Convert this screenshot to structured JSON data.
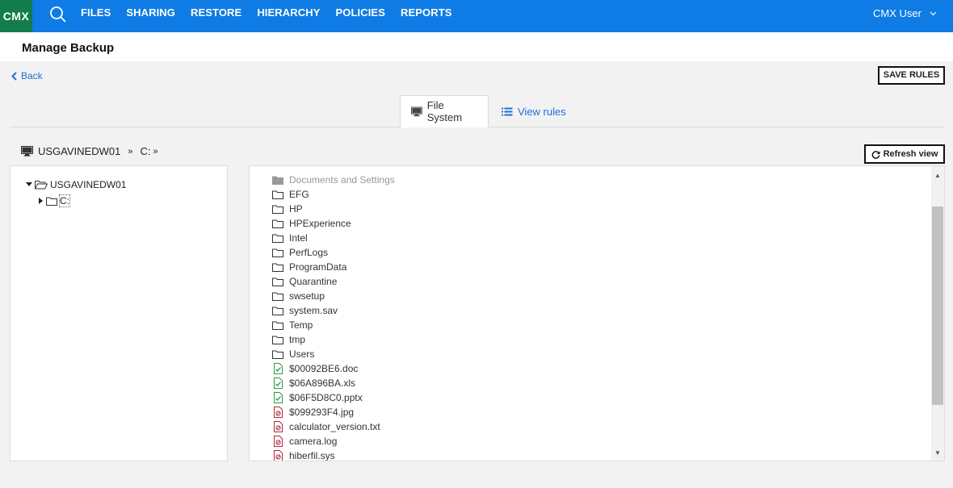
{
  "app": {
    "logo": "CMX",
    "user": "CMX User"
  },
  "nav": [
    "FILES",
    "SHARING",
    "RESTORE",
    "HIERARCHY",
    "POLICIES",
    "REPORTS"
  ],
  "page": {
    "title": "Manage Backup",
    "back": "Back",
    "save": "SAVE RULES"
  },
  "tabs": {
    "filesystem": "File System",
    "rules": "View rules"
  },
  "breadcrumb": {
    "machine": "USGAVINEDW01",
    "sep1": "»",
    "drive": "C:",
    "sep2": "»"
  },
  "refresh": "Refresh view",
  "tree": {
    "root": "USGAVINEDW01",
    "child": "C:"
  },
  "files": [
    {
      "name": "Documents and Settings",
      "icon": "folder-filled-icon",
      "dim": true
    },
    {
      "name": "EFG",
      "icon": "folder-icon"
    },
    {
      "name": "HP",
      "icon": "folder-icon"
    },
    {
      "name": "HPExperience",
      "icon": "folder-icon"
    },
    {
      "name": "Intel",
      "icon": "folder-icon"
    },
    {
      "name": "PerfLogs",
      "icon": "folder-icon"
    },
    {
      "name": "ProgramData",
      "icon": "folder-icon"
    },
    {
      "name": "Quarantine",
      "icon": "folder-icon"
    },
    {
      "name": "swsetup",
      "icon": "folder-icon"
    },
    {
      "name": "system.sav",
      "icon": "folder-icon"
    },
    {
      "name": "Temp",
      "icon": "folder-icon"
    },
    {
      "name": "tmp",
      "icon": "folder-icon"
    },
    {
      "name": "Users",
      "icon": "folder-icon"
    },
    {
      "name": "$00092BE6.doc",
      "icon": "file-check-icon"
    },
    {
      "name": "$06A896BA.xls",
      "icon": "file-check-icon"
    },
    {
      "name": "$06F5D8C0.pptx",
      "icon": "file-check-icon"
    },
    {
      "name": "$099293F4.jpg",
      "icon": "file-blocked-icon"
    },
    {
      "name": "calculator_version.txt",
      "icon": "file-blocked-icon"
    },
    {
      "name": "camera.log",
      "icon": "file-blocked-icon"
    },
    {
      "name": "hiberfil.sys",
      "icon": "file-blocked-icon"
    }
  ],
  "colors": {
    "topbar": "#0f7be4",
    "logo": "#127c4d",
    "link": "#1f6fd0",
    "check": "#2a9a4a",
    "blocked": "#b22a3a"
  }
}
